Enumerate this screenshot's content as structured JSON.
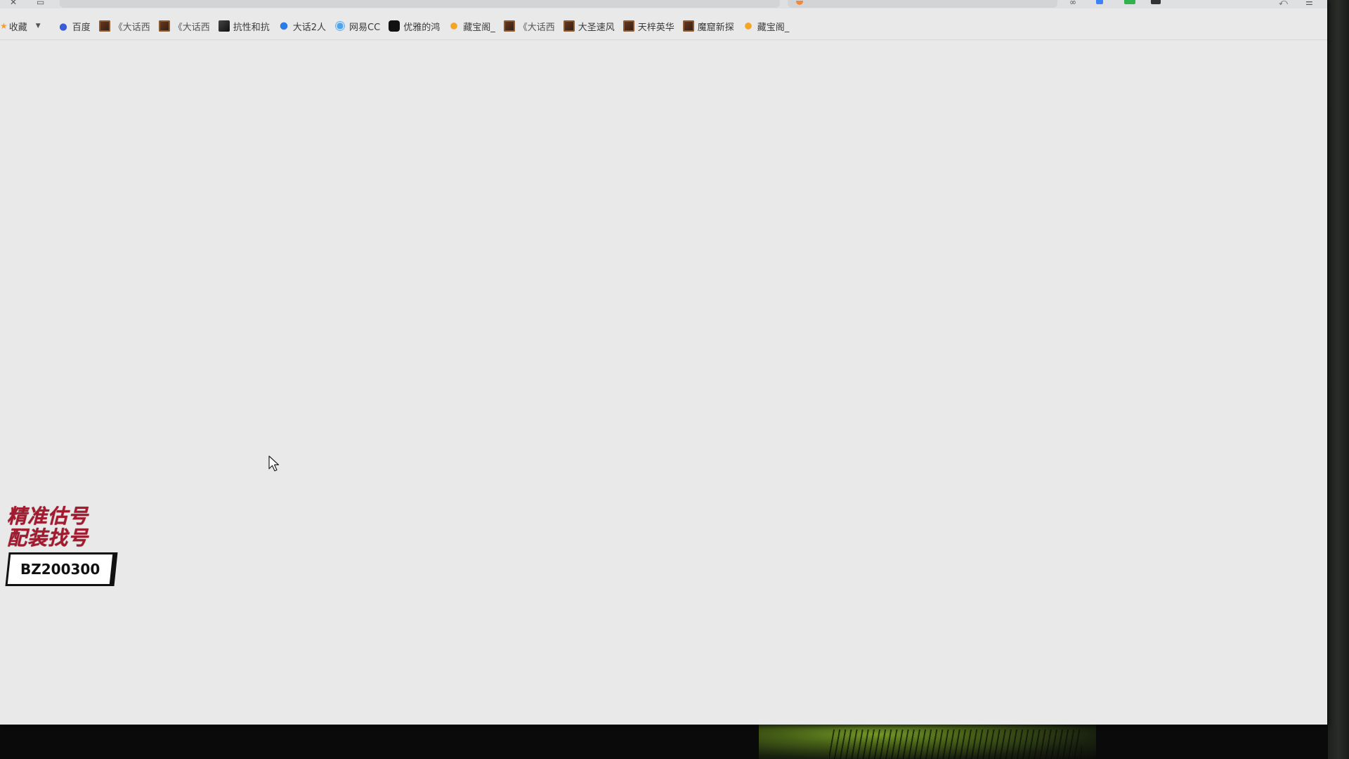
{
  "bookmarks_bar": {
    "collect_label": "收藏",
    "items": [
      {
        "label": "百度",
        "icon": "baidu-paw-icon"
      },
      {
        "label": "《大话西",
        "icon": "game-favicon"
      },
      {
        "label": "《大话西",
        "icon": "game-favicon"
      },
      {
        "label": "抗性和抗",
        "icon": "dark-favicon"
      },
      {
        "label": "大话2人",
        "icon": "blue-logo-icon"
      },
      {
        "label": "网易CC",
        "icon": "netease-cc-icon"
      },
      {
        "label": "优雅的鸿",
        "icon": "tiktok-icon"
      },
      {
        "label": "藏宝阁_",
        "icon": "cangbaoge-icon"
      },
      {
        "label": "《大话西",
        "icon": "game-favicon"
      },
      {
        "label": "大圣速风",
        "icon": "game-favicon"
      },
      {
        "label": "天梓英华",
        "icon": "game-favicon"
      },
      {
        "label": "魔窟新探",
        "icon": "game-favicon"
      },
      {
        "label": "藏宝阁_",
        "icon": "cangbaoge-icon"
      }
    ]
  },
  "promo": {
    "line1": "精准估号",
    "line2": "配装找号",
    "code": "BZ200300",
    "color": "#a5192f"
  },
  "colors": {
    "page_background": "#e9e9e9",
    "desktop_background": "#0b0c0b"
  }
}
